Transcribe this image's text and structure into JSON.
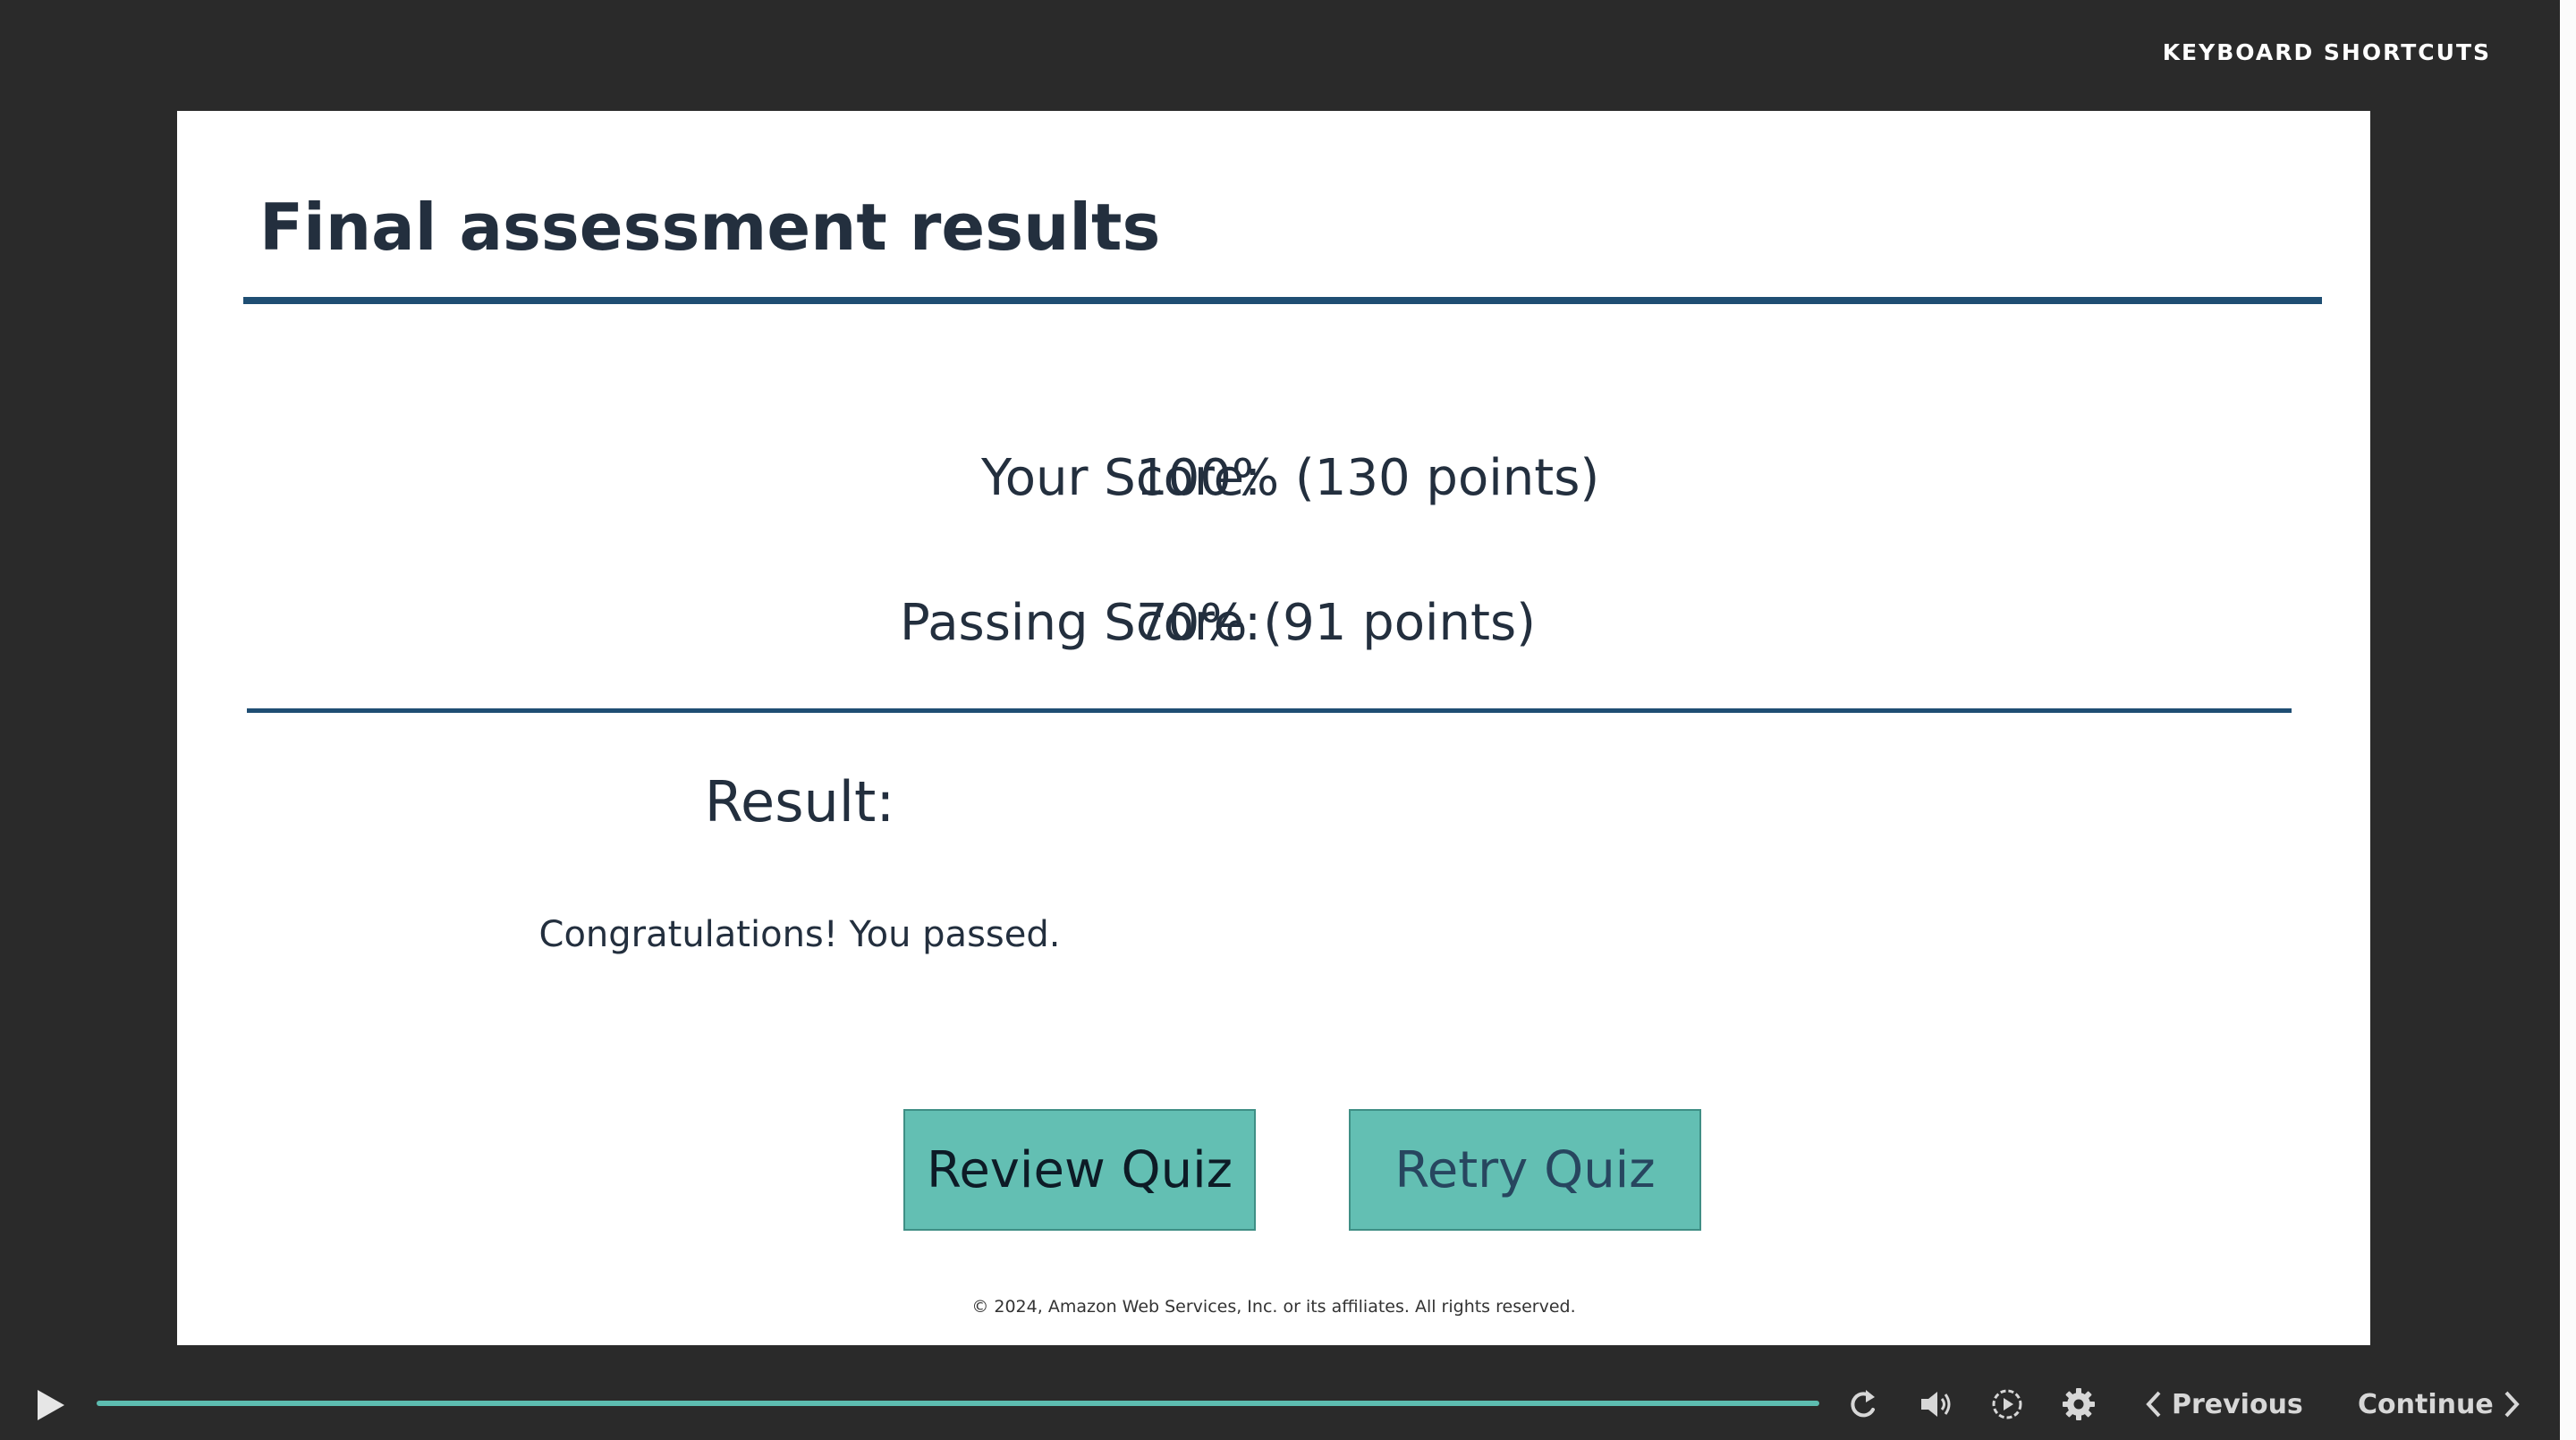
{
  "header": {
    "shortcuts_label": "KEYBOARD SHORTCUTS"
  },
  "slide": {
    "title": "Final assessment results",
    "your_score_label": "Your Score:",
    "your_score_value": "100% (130 points)",
    "passing_score_label": "Passing Score:",
    "passing_score_value": "70% (91 points)",
    "result_label": "Result:",
    "result_message": "Congratulations! You passed.",
    "review_button": "Review Quiz",
    "retry_button": "Retry Quiz",
    "copyright": "© 2024, Amazon Web Services, Inc. or its affiliates. All rights reserved."
  },
  "player": {
    "progress_fraction": 1.0,
    "previous_label": "Previous",
    "continue_label": "Continue",
    "icons": [
      "play-icon",
      "replay-icon",
      "volume-icon",
      "playback-speed-icon",
      "settings-gear-icon",
      "chevron-left-icon",
      "chevron-right-icon"
    ]
  },
  "colors": {
    "background": "#2a2a2a",
    "accent": "#63bfb3",
    "rule": "#1f4e73",
    "text": "#232f3e"
  }
}
